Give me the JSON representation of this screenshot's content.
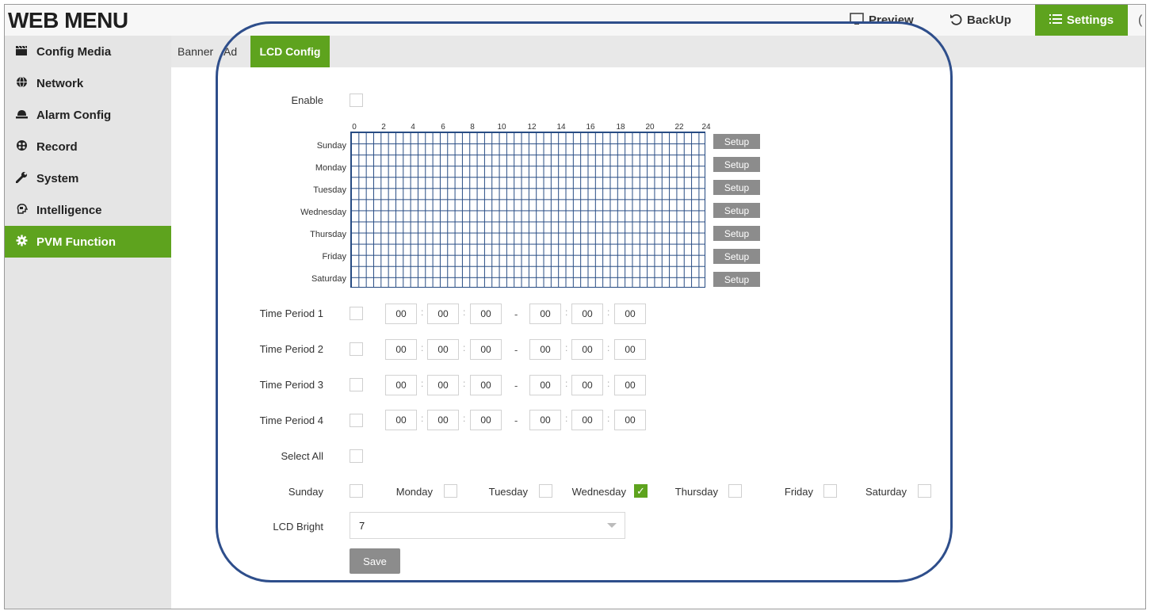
{
  "header": {
    "brand": "WEB MENU",
    "preview_label": "Preview",
    "backup_label": "BackUp",
    "settings_label": "Settings"
  },
  "sidebar": {
    "items": [
      {
        "label": "Config Media",
        "icon": "clapperboard-icon"
      },
      {
        "label": "Network",
        "icon": "globe-icon"
      },
      {
        "label": "Alarm Config",
        "icon": "alarm-bell-icon"
      },
      {
        "label": "Record",
        "icon": "record-reel-icon"
      },
      {
        "label": "System",
        "icon": "wrench-icon"
      },
      {
        "label": "Intelligence",
        "icon": "ai-head-icon"
      },
      {
        "label": "PVM Function",
        "icon": "gear-icon",
        "active": true
      }
    ]
  },
  "tabs": [
    {
      "label": "Banner"
    },
    {
      "label": "Ad"
    },
    {
      "label": "LCD Config",
      "active": true
    }
  ],
  "form": {
    "enable_label": "Enable",
    "enable_checked": false,
    "schedule": {
      "hours": [
        "0",
        "2",
        "4",
        "6",
        "8",
        "10",
        "12",
        "14",
        "16",
        "18",
        "20",
        "22",
        "24"
      ],
      "days": [
        "Sunday",
        "Monday",
        "Tuesday",
        "Wednesday",
        "Thursday",
        "Friday",
        "Saturday"
      ],
      "setup_label": "Setup"
    },
    "time_periods": [
      {
        "label": "Time Period 1",
        "checked": false,
        "values": [
          "00",
          "00",
          "00",
          "00",
          "00",
          "00"
        ]
      },
      {
        "label": "Time Period 2",
        "checked": false,
        "values": [
          "00",
          "00",
          "00",
          "00",
          "00",
          "00"
        ]
      },
      {
        "label": "Time Period 3",
        "checked": false,
        "values": [
          "00",
          "00",
          "00",
          "00",
          "00",
          "00"
        ]
      },
      {
        "label": "Time Period 4",
        "checked": false,
        "values": [
          "00",
          "00",
          "00",
          "00",
          "00",
          "00"
        ]
      }
    ],
    "time_sep": ":",
    "time_dash": "-",
    "select_all_label": "Select All",
    "select_all_checked": false,
    "weekdays": [
      {
        "label": "Sunday",
        "checked": false
      },
      {
        "label": "Monday",
        "checked": false
      },
      {
        "label": "Tuesday",
        "checked": false
      },
      {
        "label": "Wednesday",
        "checked": true
      },
      {
        "label": "Thursday",
        "checked": false
      },
      {
        "label": "Friday",
        "checked": false
      },
      {
        "label": "Saturday",
        "checked": false
      }
    ],
    "lcd_bright_label": "LCD Bright",
    "lcd_bright_value": "7",
    "save_label": "Save"
  },
  "colors": {
    "accent": "#5ea31e",
    "grid": "#254a82",
    "highlight": "#2e4e8b",
    "button_gray": "#8c8c8c"
  }
}
